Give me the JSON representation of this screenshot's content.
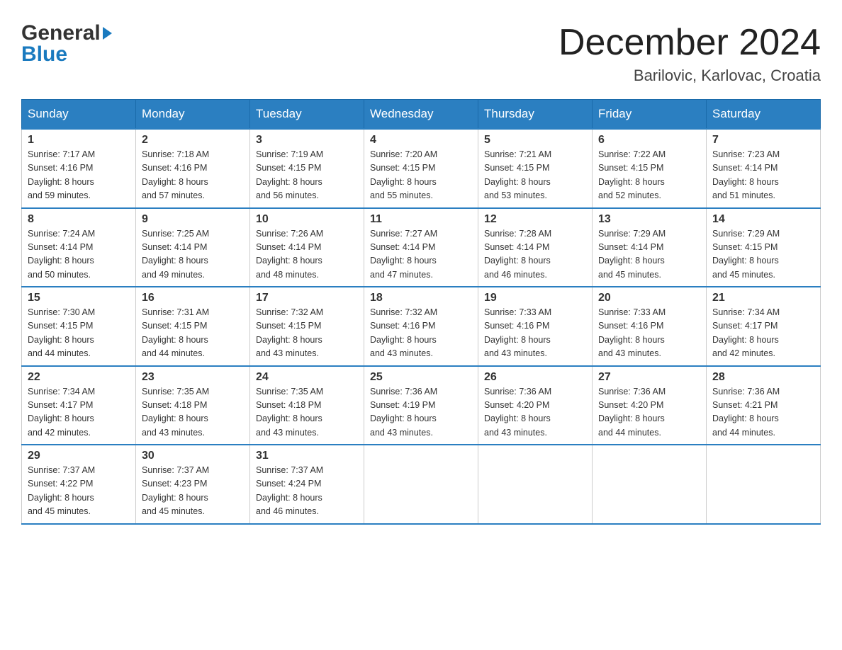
{
  "header": {
    "month_title": "December 2024",
    "location": "Barilovic, Karlovac, Croatia",
    "logo_line1": "General",
    "logo_line2": "Blue"
  },
  "weekdays": [
    "Sunday",
    "Monday",
    "Tuesday",
    "Wednesday",
    "Thursday",
    "Friday",
    "Saturday"
  ],
  "weeks": [
    [
      {
        "day": "1",
        "sunrise": "Sunrise: 7:17 AM",
        "sunset": "Sunset: 4:16 PM",
        "daylight": "Daylight: 8 hours",
        "daylight2": "and 59 minutes."
      },
      {
        "day": "2",
        "sunrise": "Sunrise: 7:18 AM",
        "sunset": "Sunset: 4:16 PM",
        "daylight": "Daylight: 8 hours",
        "daylight2": "and 57 minutes."
      },
      {
        "day": "3",
        "sunrise": "Sunrise: 7:19 AM",
        "sunset": "Sunset: 4:15 PM",
        "daylight": "Daylight: 8 hours",
        "daylight2": "and 56 minutes."
      },
      {
        "day": "4",
        "sunrise": "Sunrise: 7:20 AM",
        "sunset": "Sunset: 4:15 PM",
        "daylight": "Daylight: 8 hours",
        "daylight2": "and 55 minutes."
      },
      {
        "day": "5",
        "sunrise": "Sunrise: 7:21 AM",
        "sunset": "Sunset: 4:15 PM",
        "daylight": "Daylight: 8 hours",
        "daylight2": "and 53 minutes."
      },
      {
        "day": "6",
        "sunrise": "Sunrise: 7:22 AM",
        "sunset": "Sunset: 4:15 PM",
        "daylight": "Daylight: 8 hours",
        "daylight2": "and 52 minutes."
      },
      {
        "day": "7",
        "sunrise": "Sunrise: 7:23 AM",
        "sunset": "Sunset: 4:14 PM",
        "daylight": "Daylight: 8 hours",
        "daylight2": "and 51 minutes."
      }
    ],
    [
      {
        "day": "8",
        "sunrise": "Sunrise: 7:24 AM",
        "sunset": "Sunset: 4:14 PM",
        "daylight": "Daylight: 8 hours",
        "daylight2": "and 50 minutes."
      },
      {
        "day": "9",
        "sunrise": "Sunrise: 7:25 AM",
        "sunset": "Sunset: 4:14 PM",
        "daylight": "Daylight: 8 hours",
        "daylight2": "and 49 minutes."
      },
      {
        "day": "10",
        "sunrise": "Sunrise: 7:26 AM",
        "sunset": "Sunset: 4:14 PM",
        "daylight": "Daylight: 8 hours",
        "daylight2": "and 48 minutes."
      },
      {
        "day": "11",
        "sunrise": "Sunrise: 7:27 AM",
        "sunset": "Sunset: 4:14 PM",
        "daylight": "Daylight: 8 hours",
        "daylight2": "and 47 minutes."
      },
      {
        "day": "12",
        "sunrise": "Sunrise: 7:28 AM",
        "sunset": "Sunset: 4:14 PM",
        "daylight": "Daylight: 8 hours",
        "daylight2": "and 46 minutes."
      },
      {
        "day": "13",
        "sunrise": "Sunrise: 7:29 AM",
        "sunset": "Sunset: 4:14 PM",
        "daylight": "Daylight: 8 hours",
        "daylight2": "and 45 minutes."
      },
      {
        "day": "14",
        "sunrise": "Sunrise: 7:29 AM",
        "sunset": "Sunset: 4:15 PM",
        "daylight": "Daylight: 8 hours",
        "daylight2": "and 45 minutes."
      }
    ],
    [
      {
        "day": "15",
        "sunrise": "Sunrise: 7:30 AM",
        "sunset": "Sunset: 4:15 PM",
        "daylight": "Daylight: 8 hours",
        "daylight2": "and 44 minutes."
      },
      {
        "day": "16",
        "sunrise": "Sunrise: 7:31 AM",
        "sunset": "Sunset: 4:15 PM",
        "daylight": "Daylight: 8 hours",
        "daylight2": "and 44 minutes."
      },
      {
        "day": "17",
        "sunrise": "Sunrise: 7:32 AM",
        "sunset": "Sunset: 4:15 PM",
        "daylight": "Daylight: 8 hours",
        "daylight2": "and 43 minutes."
      },
      {
        "day": "18",
        "sunrise": "Sunrise: 7:32 AM",
        "sunset": "Sunset: 4:16 PM",
        "daylight": "Daylight: 8 hours",
        "daylight2": "and 43 minutes."
      },
      {
        "day": "19",
        "sunrise": "Sunrise: 7:33 AM",
        "sunset": "Sunset: 4:16 PM",
        "daylight": "Daylight: 8 hours",
        "daylight2": "and 43 minutes."
      },
      {
        "day": "20",
        "sunrise": "Sunrise: 7:33 AM",
        "sunset": "Sunset: 4:16 PM",
        "daylight": "Daylight: 8 hours",
        "daylight2": "and 43 minutes."
      },
      {
        "day": "21",
        "sunrise": "Sunrise: 7:34 AM",
        "sunset": "Sunset: 4:17 PM",
        "daylight": "Daylight: 8 hours",
        "daylight2": "and 42 minutes."
      }
    ],
    [
      {
        "day": "22",
        "sunrise": "Sunrise: 7:34 AM",
        "sunset": "Sunset: 4:17 PM",
        "daylight": "Daylight: 8 hours",
        "daylight2": "and 42 minutes."
      },
      {
        "day": "23",
        "sunrise": "Sunrise: 7:35 AM",
        "sunset": "Sunset: 4:18 PM",
        "daylight": "Daylight: 8 hours",
        "daylight2": "and 43 minutes."
      },
      {
        "day": "24",
        "sunrise": "Sunrise: 7:35 AM",
        "sunset": "Sunset: 4:18 PM",
        "daylight": "Daylight: 8 hours",
        "daylight2": "and 43 minutes."
      },
      {
        "day": "25",
        "sunrise": "Sunrise: 7:36 AM",
        "sunset": "Sunset: 4:19 PM",
        "daylight": "Daylight: 8 hours",
        "daylight2": "and 43 minutes."
      },
      {
        "day": "26",
        "sunrise": "Sunrise: 7:36 AM",
        "sunset": "Sunset: 4:20 PM",
        "daylight": "Daylight: 8 hours",
        "daylight2": "and 43 minutes."
      },
      {
        "day": "27",
        "sunrise": "Sunrise: 7:36 AM",
        "sunset": "Sunset: 4:20 PM",
        "daylight": "Daylight: 8 hours",
        "daylight2": "and 44 minutes."
      },
      {
        "day": "28",
        "sunrise": "Sunrise: 7:36 AM",
        "sunset": "Sunset: 4:21 PM",
        "daylight": "Daylight: 8 hours",
        "daylight2": "and 44 minutes."
      }
    ],
    [
      {
        "day": "29",
        "sunrise": "Sunrise: 7:37 AM",
        "sunset": "Sunset: 4:22 PM",
        "daylight": "Daylight: 8 hours",
        "daylight2": "and 45 minutes."
      },
      {
        "day": "30",
        "sunrise": "Sunrise: 7:37 AM",
        "sunset": "Sunset: 4:23 PM",
        "daylight": "Daylight: 8 hours",
        "daylight2": "and 45 minutes."
      },
      {
        "day": "31",
        "sunrise": "Sunrise: 7:37 AM",
        "sunset": "Sunset: 4:24 PM",
        "daylight": "Daylight: 8 hours",
        "daylight2": "and 46 minutes."
      },
      null,
      null,
      null,
      null
    ]
  ]
}
